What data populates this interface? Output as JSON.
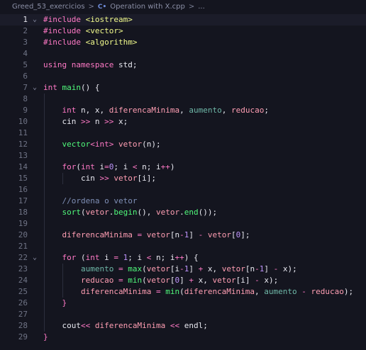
{
  "breadcrumb": {
    "folder": "Greed_53_exercicios",
    "separator": ">",
    "file_icon": "C•",
    "file": "Operation with X.cpp",
    "more": "..."
  },
  "editor": {
    "active_line": 1,
    "lines": [
      {
        "n": "1",
        "fold": "⌄",
        "tokens": [
          [
            "kw",
            "#include "
          ],
          [
            "str",
            "<iostream>"
          ]
        ]
      },
      {
        "n": "2",
        "fold": "",
        "tokens": [
          [
            "kw",
            "#include "
          ],
          [
            "str",
            "<vector>"
          ]
        ]
      },
      {
        "n": "3",
        "fold": "",
        "tokens": [
          [
            "kw",
            "#include "
          ],
          [
            "str",
            "<algorithm>"
          ]
        ]
      },
      {
        "n": "4",
        "fold": "",
        "tokens": []
      },
      {
        "n": "5",
        "fold": "",
        "tokens": [
          [
            "kw",
            "using namespace "
          ],
          [
            "pl",
            "std;"
          ]
        ]
      },
      {
        "n": "6",
        "fold": "",
        "tokens": []
      },
      {
        "n": "7",
        "fold": "⌄",
        "tokens": [
          [
            "kw",
            "int "
          ],
          [
            "fn",
            "main"
          ],
          [
            "pl",
            "() {"
          ]
        ]
      },
      {
        "n": "8",
        "fold": "",
        "tokens": []
      },
      {
        "n": "9",
        "fold": "",
        "tokens": [
          [
            "pl",
            "    "
          ],
          [
            "kw",
            "int "
          ],
          [
            "pl",
            "n, x, "
          ],
          [
            "var",
            "diferencaMinima"
          ],
          [
            "pl",
            ", "
          ],
          [
            "aum",
            "aumento"
          ],
          [
            "pl",
            ", "
          ],
          [
            "var",
            "reducao"
          ],
          [
            "pl",
            ";"
          ]
        ]
      },
      {
        "n": "10",
        "fold": "",
        "tokens": [
          [
            "pl",
            "    cin "
          ],
          [
            "op",
            ">>"
          ],
          [
            "pl",
            " n "
          ],
          [
            "op",
            ">>"
          ],
          [
            "pl",
            " x;"
          ]
        ]
      },
      {
        "n": "11",
        "fold": "",
        "tokens": []
      },
      {
        "n": "12",
        "fold": "",
        "tokens": [
          [
            "pl",
            "    "
          ],
          [
            "fn",
            "vector"
          ],
          [
            "op",
            "<"
          ],
          [
            "kw",
            "int"
          ],
          [
            "op",
            ">"
          ],
          [
            "pl",
            " "
          ],
          [
            "var",
            "vetor"
          ],
          [
            "pl",
            "(n);"
          ]
        ]
      },
      {
        "n": "13",
        "fold": "",
        "tokens": []
      },
      {
        "n": "14",
        "fold": "",
        "tokens": [
          [
            "pl",
            "    "
          ],
          [
            "kw",
            "for"
          ],
          [
            "pl",
            "("
          ],
          [
            "kw",
            "int "
          ],
          [
            "pl",
            "i"
          ],
          [
            "op",
            "="
          ],
          [
            "num",
            "0"
          ],
          [
            "pl",
            "; i "
          ],
          [
            "op",
            "<"
          ],
          [
            "pl",
            " n; i"
          ],
          [
            "op",
            "++"
          ],
          [
            "pl",
            ")"
          ]
        ]
      },
      {
        "n": "15",
        "fold": "",
        "tokens": [
          [
            "pl",
            "        cin "
          ],
          [
            "op",
            ">>"
          ],
          [
            "pl",
            " "
          ],
          [
            "var",
            "vetor"
          ],
          [
            "pl",
            "[i];"
          ]
        ]
      },
      {
        "n": "16",
        "fold": "",
        "tokens": []
      },
      {
        "n": "17",
        "fold": "",
        "tokens": [
          [
            "cmt",
            "    //ordena o vetor"
          ]
        ]
      },
      {
        "n": "18",
        "fold": "",
        "tokens": [
          [
            "pl",
            "    "
          ],
          [
            "fn",
            "sort"
          ],
          [
            "pl",
            "("
          ],
          [
            "var",
            "vetor"
          ],
          [
            "pl",
            "."
          ],
          [
            "fn",
            "begin"
          ],
          [
            "pl",
            "(), "
          ],
          [
            "var",
            "vetor"
          ],
          [
            "pl",
            "."
          ],
          [
            "fn",
            "end"
          ],
          [
            "pl",
            "());"
          ]
        ]
      },
      {
        "n": "19",
        "fold": "",
        "tokens": []
      },
      {
        "n": "20",
        "fold": "",
        "tokens": [
          [
            "pl",
            "    "
          ],
          [
            "var",
            "diferencaMinima"
          ],
          [
            "pl",
            " "
          ],
          [
            "op",
            "="
          ],
          [
            "pl",
            " "
          ],
          [
            "var",
            "vetor"
          ],
          [
            "pl",
            "[n"
          ],
          [
            "op",
            "-"
          ],
          [
            "num",
            "1"
          ],
          [
            "pl",
            "] "
          ],
          [
            "op",
            "-"
          ],
          [
            "pl",
            " "
          ],
          [
            "var",
            "vetor"
          ],
          [
            "pl",
            "["
          ],
          [
            "num",
            "0"
          ],
          [
            "pl",
            "];"
          ]
        ]
      },
      {
        "n": "21",
        "fold": "",
        "tokens": []
      },
      {
        "n": "22",
        "fold": "⌄",
        "tokens": [
          [
            "pl",
            "    "
          ],
          [
            "kw",
            "for"
          ],
          [
            "pl",
            " ("
          ],
          [
            "kw",
            "int "
          ],
          [
            "pl",
            "i "
          ],
          [
            "op",
            "="
          ],
          [
            "pl",
            " "
          ],
          [
            "num",
            "1"
          ],
          [
            "pl",
            "; i "
          ],
          [
            "op",
            "<"
          ],
          [
            "pl",
            " n; i"
          ],
          [
            "op",
            "++"
          ],
          [
            "pl",
            ") {"
          ]
        ]
      },
      {
        "n": "23",
        "fold": "",
        "tokens": [
          [
            "pl",
            "        "
          ],
          [
            "aum",
            "aumento"
          ],
          [
            "pl",
            " "
          ],
          [
            "op",
            "="
          ],
          [
            "pl",
            " "
          ],
          [
            "fn",
            "max"
          ],
          [
            "pl",
            "("
          ],
          [
            "var",
            "vetor"
          ],
          [
            "pl",
            "[i"
          ],
          [
            "op",
            "-"
          ],
          [
            "num",
            "1"
          ],
          [
            "pl",
            "] "
          ],
          [
            "op",
            "+"
          ],
          [
            "pl",
            " x, "
          ],
          [
            "var",
            "vetor"
          ],
          [
            "pl",
            "[n"
          ],
          [
            "op",
            "-"
          ],
          [
            "num",
            "1"
          ],
          [
            "pl",
            "] "
          ],
          [
            "op",
            "-"
          ],
          [
            "pl",
            " x);"
          ]
        ]
      },
      {
        "n": "24",
        "fold": "",
        "tokens": [
          [
            "pl",
            "        "
          ],
          [
            "var",
            "reducao"
          ],
          [
            "pl",
            " "
          ],
          [
            "op",
            "="
          ],
          [
            "pl",
            " "
          ],
          [
            "fn",
            "min"
          ],
          [
            "pl",
            "("
          ],
          [
            "var",
            "vetor"
          ],
          [
            "pl",
            "["
          ],
          [
            "num",
            "0"
          ],
          [
            "pl",
            "] "
          ],
          [
            "op",
            "+"
          ],
          [
            "pl",
            " x, "
          ],
          [
            "var",
            "vetor"
          ],
          [
            "pl",
            "[i] "
          ],
          [
            "op",
            "-"
          ],
          [
            "pl",
            " x);"
          ]
        ]
      },
      {
        "n": "25",
        "fold": "",
        "tokens": [
          [
            "pl",
            "        "
          ],
          [
            "var",
            "diferencaMinima"
          ],
          [
            "pl",
            " "
          ],
          [
            "op",
            "="
          ],
          [
            "pl",
            " "
          ],
          [
            "fn",
            "min"
          ],
          [
            "pl",
            "("
          ],
          [
            "var",
            "diferencaMinima"
          ],
          [
            "pl",
            ", "
          ],
          [
            "aum",
            "aumento"
          ],
          [
            "pl",
            " "
          ],
          [
            "op",
            "-"
          ],
          [
            "pl",
            " "
          ],
          [
            "var",
            "reducao"
          ],
          [
            "pl",
            ");"
          ]
        ]
      },
      {
        "n": "26",
        "fold": "",
        "tokens": [
          [
            "pl",
            "    "
          ],
          [
            "op",
            "}"
          ]
        ]
      },
      {
        "n": "27",
        "fold": "",
        "tokens": []
      },
      {
        "n": "28",
        "fold": "",
        "tokens": [
          [
            "pl",
            "    cout"
          ],
          [
            "op",
            "<<"
          ],
          [
            "pl",
            " "
          ],
          [
            "var",
            "diferencaMinima"
          ],
          [
            "pl",
            " "
          ],
          [
            "op",
            "<<"
          ],
          [
            "pl",
            " endl;"
          ]
        ]
      },
      {
        "n": "29",
        "fold": "",
        "tokens": [
          [
            "op",
            "}"
          ]
        ]
      }
    ]
  },
  "colors": {
    "background": "#14151f",
    "keyword": "#ff79c6",
    "function": "#50fa7b",
    "variable": "#ff9eb3",
    "number": "#bd93f9",
    "string": "#f1fa8c",
    "comment": "#7f8fb6"
  }
}
